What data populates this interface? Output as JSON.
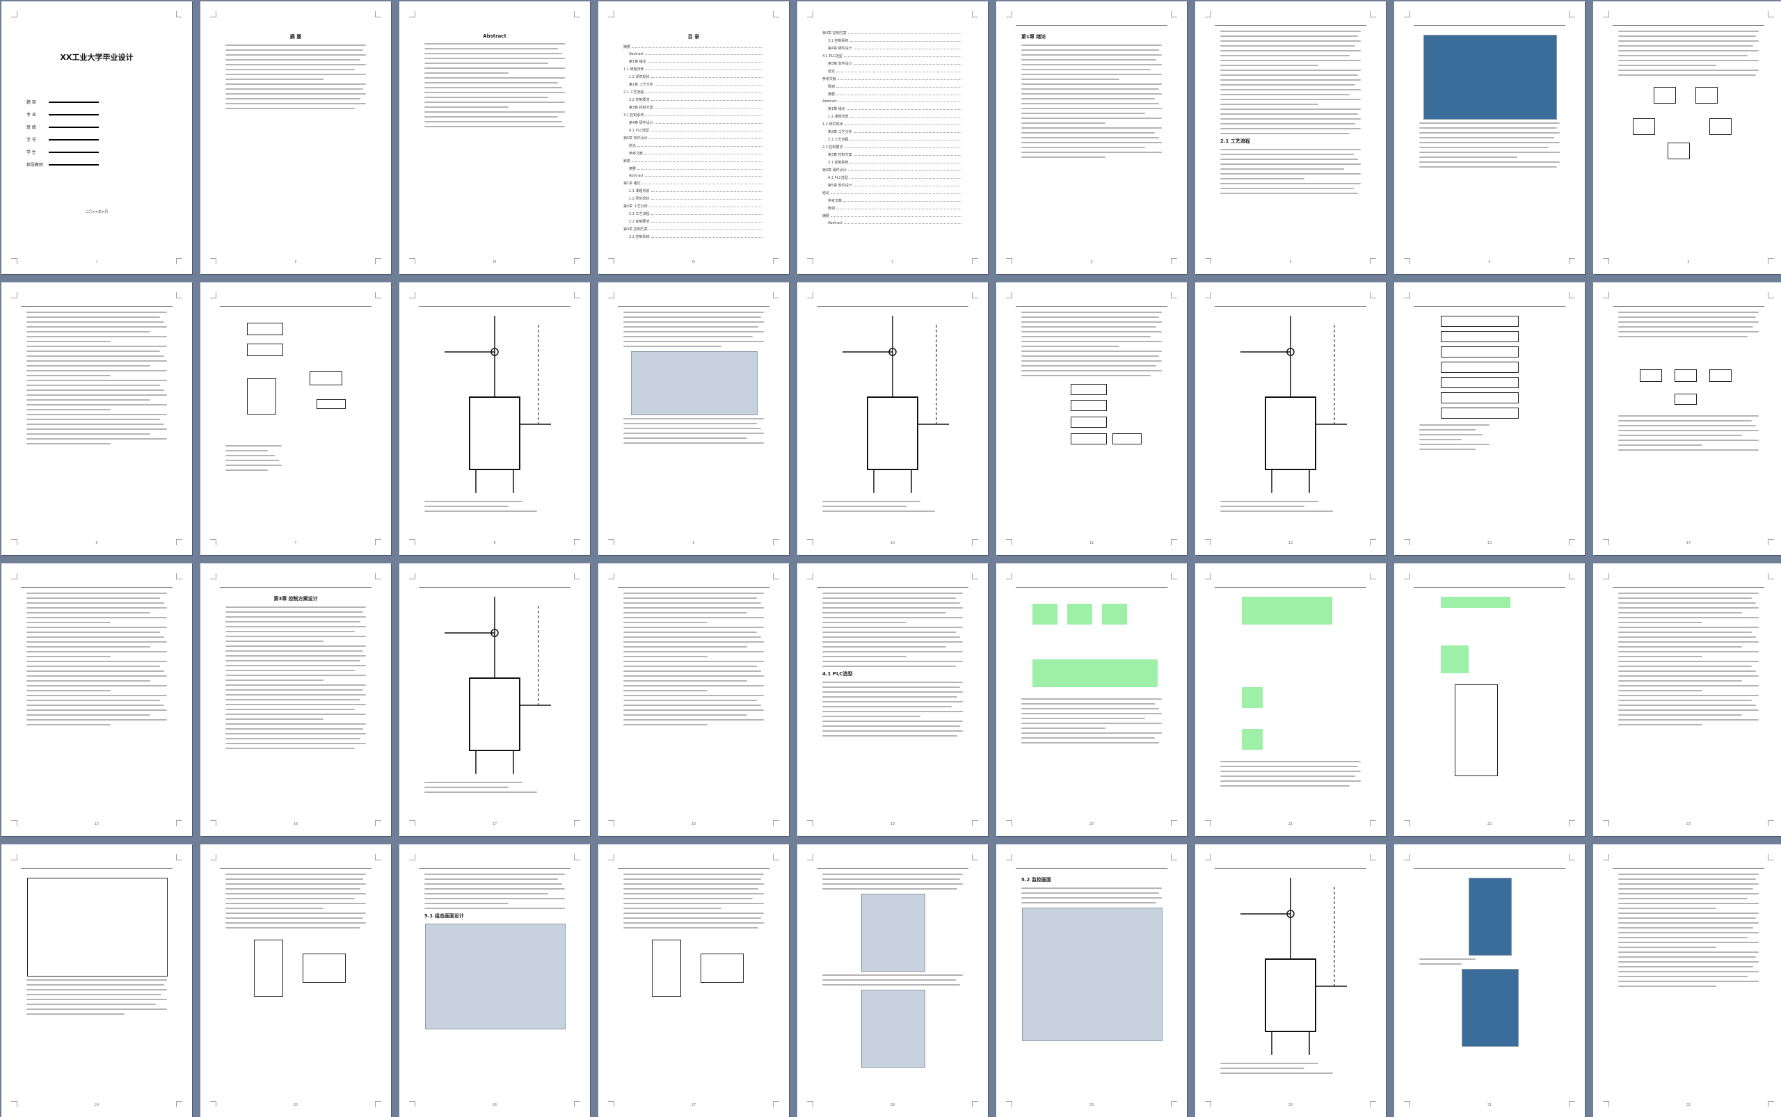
{
  "document": {
    "cover": {
      "title": "XX工业大学毕业设计",
      "fields": [
        {
          "label": "题 目"
        },
        {
          "label": "专 业"
        },
        {
          "label": "班 级"
        },
        {
          "label": "学 号"
        },
        {
          "label": "学 生"
        },
        {
          "label": "指导教师"
        }
      ],
      "date": "二〇××年×月"
    },
    "headings": {
      "abstract_cn": "摘 要",
      "abstract_en": "Abstract",
      "toc": "目 录",
      "ch_intro": "第1章 绪论",
      "process": "2.1 工艺流程",
      "ch_scheme": "第3章 控制方案设计",
      "plc": "4.1 PLC选型",
      "hmi": "5.1 组态画面设计",
      "monitor": "5.2 监控画面"
    },
    "toc_entries": [
      "摘要",
      "Abstract",
      "第1章 绪论",
      "1.1 课题背景",
      "1.2 研究现状",
      "第2章 工艺分析",
      "2.1 工艺流程",
      "2.2 控制要求",
      "第3章 控制方案",
      "3.1 控制系统",
      "第4章 硬件设计",
      "4.1 PLC选型",
      "第5章 软件设计",
      "结论",
      "参考文献",
      "致谢"
    ],
    "pages": {
      "page_numbers": [
        "I",
        "II",
        "III",
        "IV",
        "1",
        "2",
        "3",
        "4",
        "5",
        "6",
        "7",
        "8",
        "9",
        "10",
        "11",
        "12",
        "13",
        "14",
        "15",
        "16",
        "17",
        "18",
        "19",
        "20",
        "21",
        "22",
        "23",
        "24",
        "25",
        "26",
        "27",
        "28",
        "29",
        "30",
        "31",
        "32"
      ]
    }
  }
}
